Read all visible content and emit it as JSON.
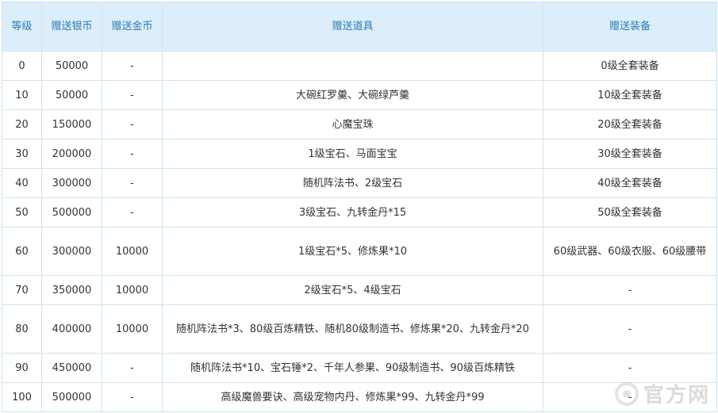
{
  "table": {
    "headers": [
      "等级",
      "赠送银币",
      "赠送金币",
      "赠送道具",
      "赠送装备"
    ],
    "rows": [
      [
        "0",
        "50000",
        "-",
        "",
        "0级全套装备"
      ],
      [
        "10",
        "50000",
        "-",
        "大碗红罗羹、大碗绿芦羹",
        "10级全套装备"
      ],
      [
        "20",
        "150000",
        "-",
        "心魔宝珠",
        "20级全套装备"
      ],
      [
        "30",
        "200000",
        "-",
        "1级宝石、马面宝宝",
        "30级全套装备"
      ],
      [
        "40",
        "300000",
        "-",
        "随机阵法书、2级宝石",
        "40级全套装备"
      ],
      [
        "50",
        "500000",
        "-",
        "3级宝石、九转金丹*15",
        "50级全套装备"
      ],
      [
        "60",
        "300000",
        "10000",
        "1级宝石*5、修炼果*10",
        "60级武器、60级衣服、60级腰带"
      ],
      [
        "70",
        "350000",
        "10000",
        "2级宝石*5、4级宝石",
        "-"
      ],
      [
        "80",
        "400000",
        "10000",
        "随机阵法书*3、80级百炼精铁、随机80级制造书、修炼果*20、九转金丹*20",
        "-"
      ],
      [
        "90",
        "450000",
        "-",
        "随机阵法书*10、宝石锤*2、千年人参果、90级制造书、90级百炼精铁",
        "-"
      ],
      [
        "100",
        "500000",
        "-",
        "高级魔兽要诀、高级宠物内丹、修炼果*99、九转金丹*99",
        "-"
      ]
    ]
  },
  "watermark": {
    "text": "官方网",
    "icon": "site-logo-icon"
  }
}
